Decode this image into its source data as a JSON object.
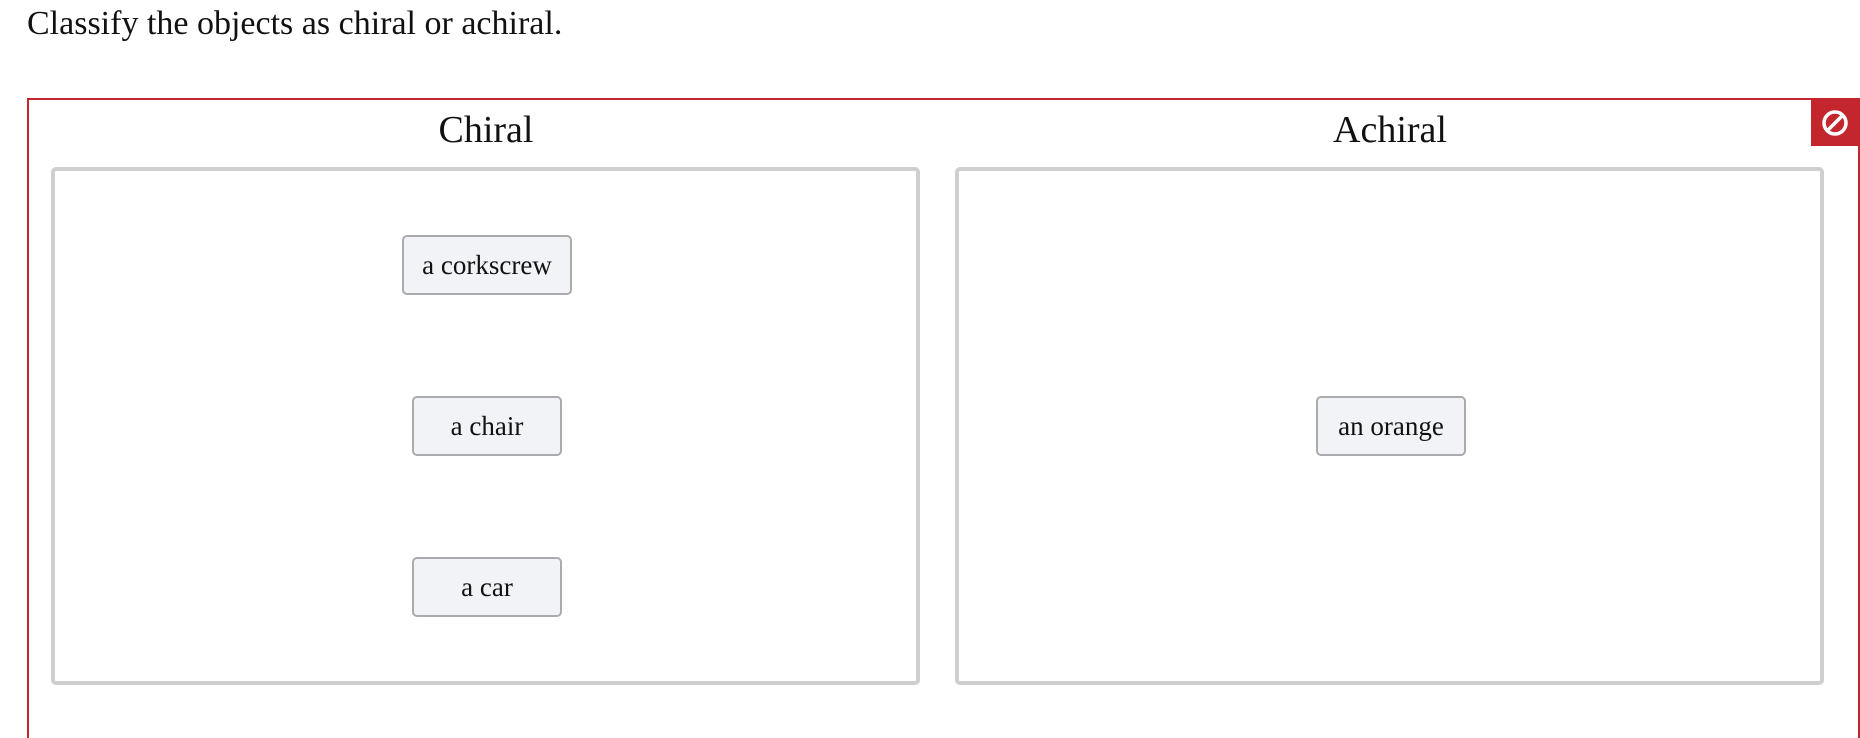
{
  "prompt": "Classify the objects as chiral or achiral.",
  "colors": {
    "accent": "#c4262e",
    "bin_border": "#cfcfcf",
    "chip_bg": "#f2f3f7"
  },
  "reset": {
    "icon": "no-entry-icon"
  },
  "bins": {
    "chiral": {
      "title": "Chiral",
      "items": [
        "a corkscrew",
        "a chair",
        "a car"
      ]
    },
    "achiral": {
      "title": "Achiral",
      "items": [
        "an orange"
      ]
    }
  }
}
